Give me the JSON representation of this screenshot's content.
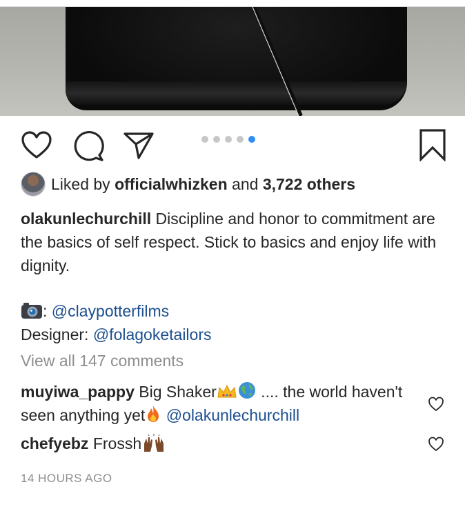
{
  "post": {
    "liked_by_prefix": "Liked by",
    "liked_by_user": "officialwhizken",
    "liked_by_and": "and",
    "liked_by_others": "3,722 others",
    "caption_user": "olakunlechurchill",
    "caption_text": "Discipline and honor to commitment are the basics of self respect. Stick to basics and enjoy life with dignity.",
    "credit_photo_prefix": ":",
    "credit_photo_handle": "@claypotterfilms",
    "credit_designer_label": "Designer:",
    "credit_designer_handle": "@folagoketailors",
    "view_all_comments": "View all 147 comments",
    "timestamp": "14 HOURS AGO",
    "carousel": {
      "count": 5,
      "active_index": 4
    }
  },
  "comments": [
    {
      "user": "muyiwa_pappy",
      "text_a": "Big Shaker",
      "text_b": ".... the world haven't seen anything yet",
      "mention": "@olakunlechurchill"
    },
    {
      "user": "chefyebz",
      "text_a": "Frossh"
    }
  ],
  "icons": {
    "like": "heart-outline-icon",
    "comment": "speech-bubble-icon",
    "share": "paper-plane-icon",
    "save": "bookmark-icon",
    "camera": "camera-emoji",
    "crown": "crown-emoji",
    "globe": "globe-emoji",
    "fire": "fire-emoji",
    "hands": "raised-hands-emoji"
  },
  "colors": {
    "text": "#262626",
    "muted": "#8e8e8e",
    "link": "#1d4f8f",
    "active_dot": "#2f8ef0",
    "inactive_dot": "#c7c7c7"
  }
}
